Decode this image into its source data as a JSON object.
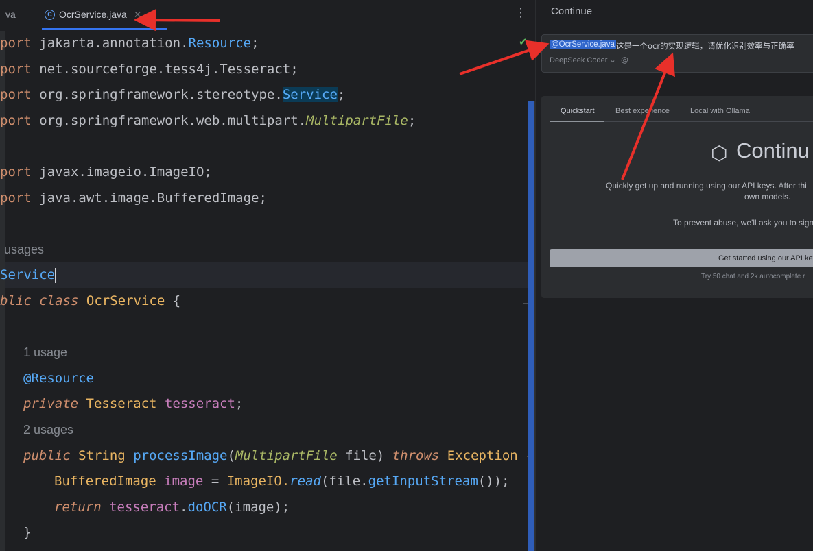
{
  "tabs": {
    "prev_label": "va",
    "active_label": "OcrService.java",
    "active_icon_letter": "C",
    "close_glyph": "✕",
    "more_glyph": "⋮"
  },
  "code": {
    "imports": [
      {
        "kw": "port",
        "pkg": " jakarta.annotation.",
        "cls": "Resource",
        "end": ";"
      },
      {
        "kw": "port",
        "pkg": " net.sourceforge.tess4j.Tesseract",
        "cls": "",
        "end": ";"
      },
      {
        "kw": "port",
        "pkg": " org.springframework.stereotype.",
        "cls": "Service",
        "end": ";"
      },
      {
        "kw": "port",
        "pkg": " org.springframework.web.multipart.",
        "cls": "MultipartFile",
        "end": ";"
      },
      {
        "kw": "port",
        "pkg": " javax.imageio.ImageIO",
        "cls": "",
        "end": ";"
      },
      {
        "kw": "port",
        "pkg": " java.awt.image.BufferedImage",
        "cls": "",
        "end": ";"
      }
    ],
    "usages_class": "usages",
    "annotation_service": "Service",
    "class_decl": {
      "kw1": "blic",
      "kw2": "class",
      "name": "OcrService",
      "brace": " {"
    },
    "usage_field": "1 usage",
    "field_annotation": "@Resource",
    "field_decl": {
      "kw": "private",
      "type": "Tesseract",
      "name": "tesseract",
      "end": ";"
    },
    "usage_method": "2 usages",
    "method_decl": {
      "kw": "public",
      "ret": "String",
      "name": "processImage",
      "open": "(",
      "ptype": "MultipartFile",
      "pname": " file) ",
      "throws": "throws",
      "exc": " Exception {"
    },
    "line_read": {
      "type": "BufferedImage",
      "var": "image",
      "eq": " = ",
      "cls": "ImageIO.",
      "mth": "read",
      "rest_a": "(file.",
      "mth2": "getInputStream",
      "rest_b": "());"
    },
    "line_return": {
      "kw": "return",
      "obj": "tesseract",
      "dot": ".",
      "mth": "doOCR",
      "rest": "(image);"
    },
    "close_brace": "}"
  },
  "panel": {
    "title": "Continue",
    "mention": "@OcrService.java",
    "message": "这是一个ocr的实现逻辑，请优化识别效率与正确率",
    "model": "DeepSeek Coder",
    "model_chevron": "⌄",
    "at_glyph": "@",
    "onboarding": {
      "tabs": [
        "Quickstart",
        "Best experience",
        "Local with Ollama"
      ],
      "logo_text": "Continu",
      "logo_glyph": "⬡",
      "desc_line1": "Quickly get up and running using our API keys. After thi",
      "desc_line2": "own models.",
      "desc_line3": "To prevent abuse, we'll ask you to sign",
      "button": "Get started using our API key",
      "note": "Try 50 chat and 2k autocomplete r"
    }
  },
  "colors": {
    "arrow": "#e8302a",
    "accent": "#3574f0",
    "check": "#5fb85f"
  }
}
